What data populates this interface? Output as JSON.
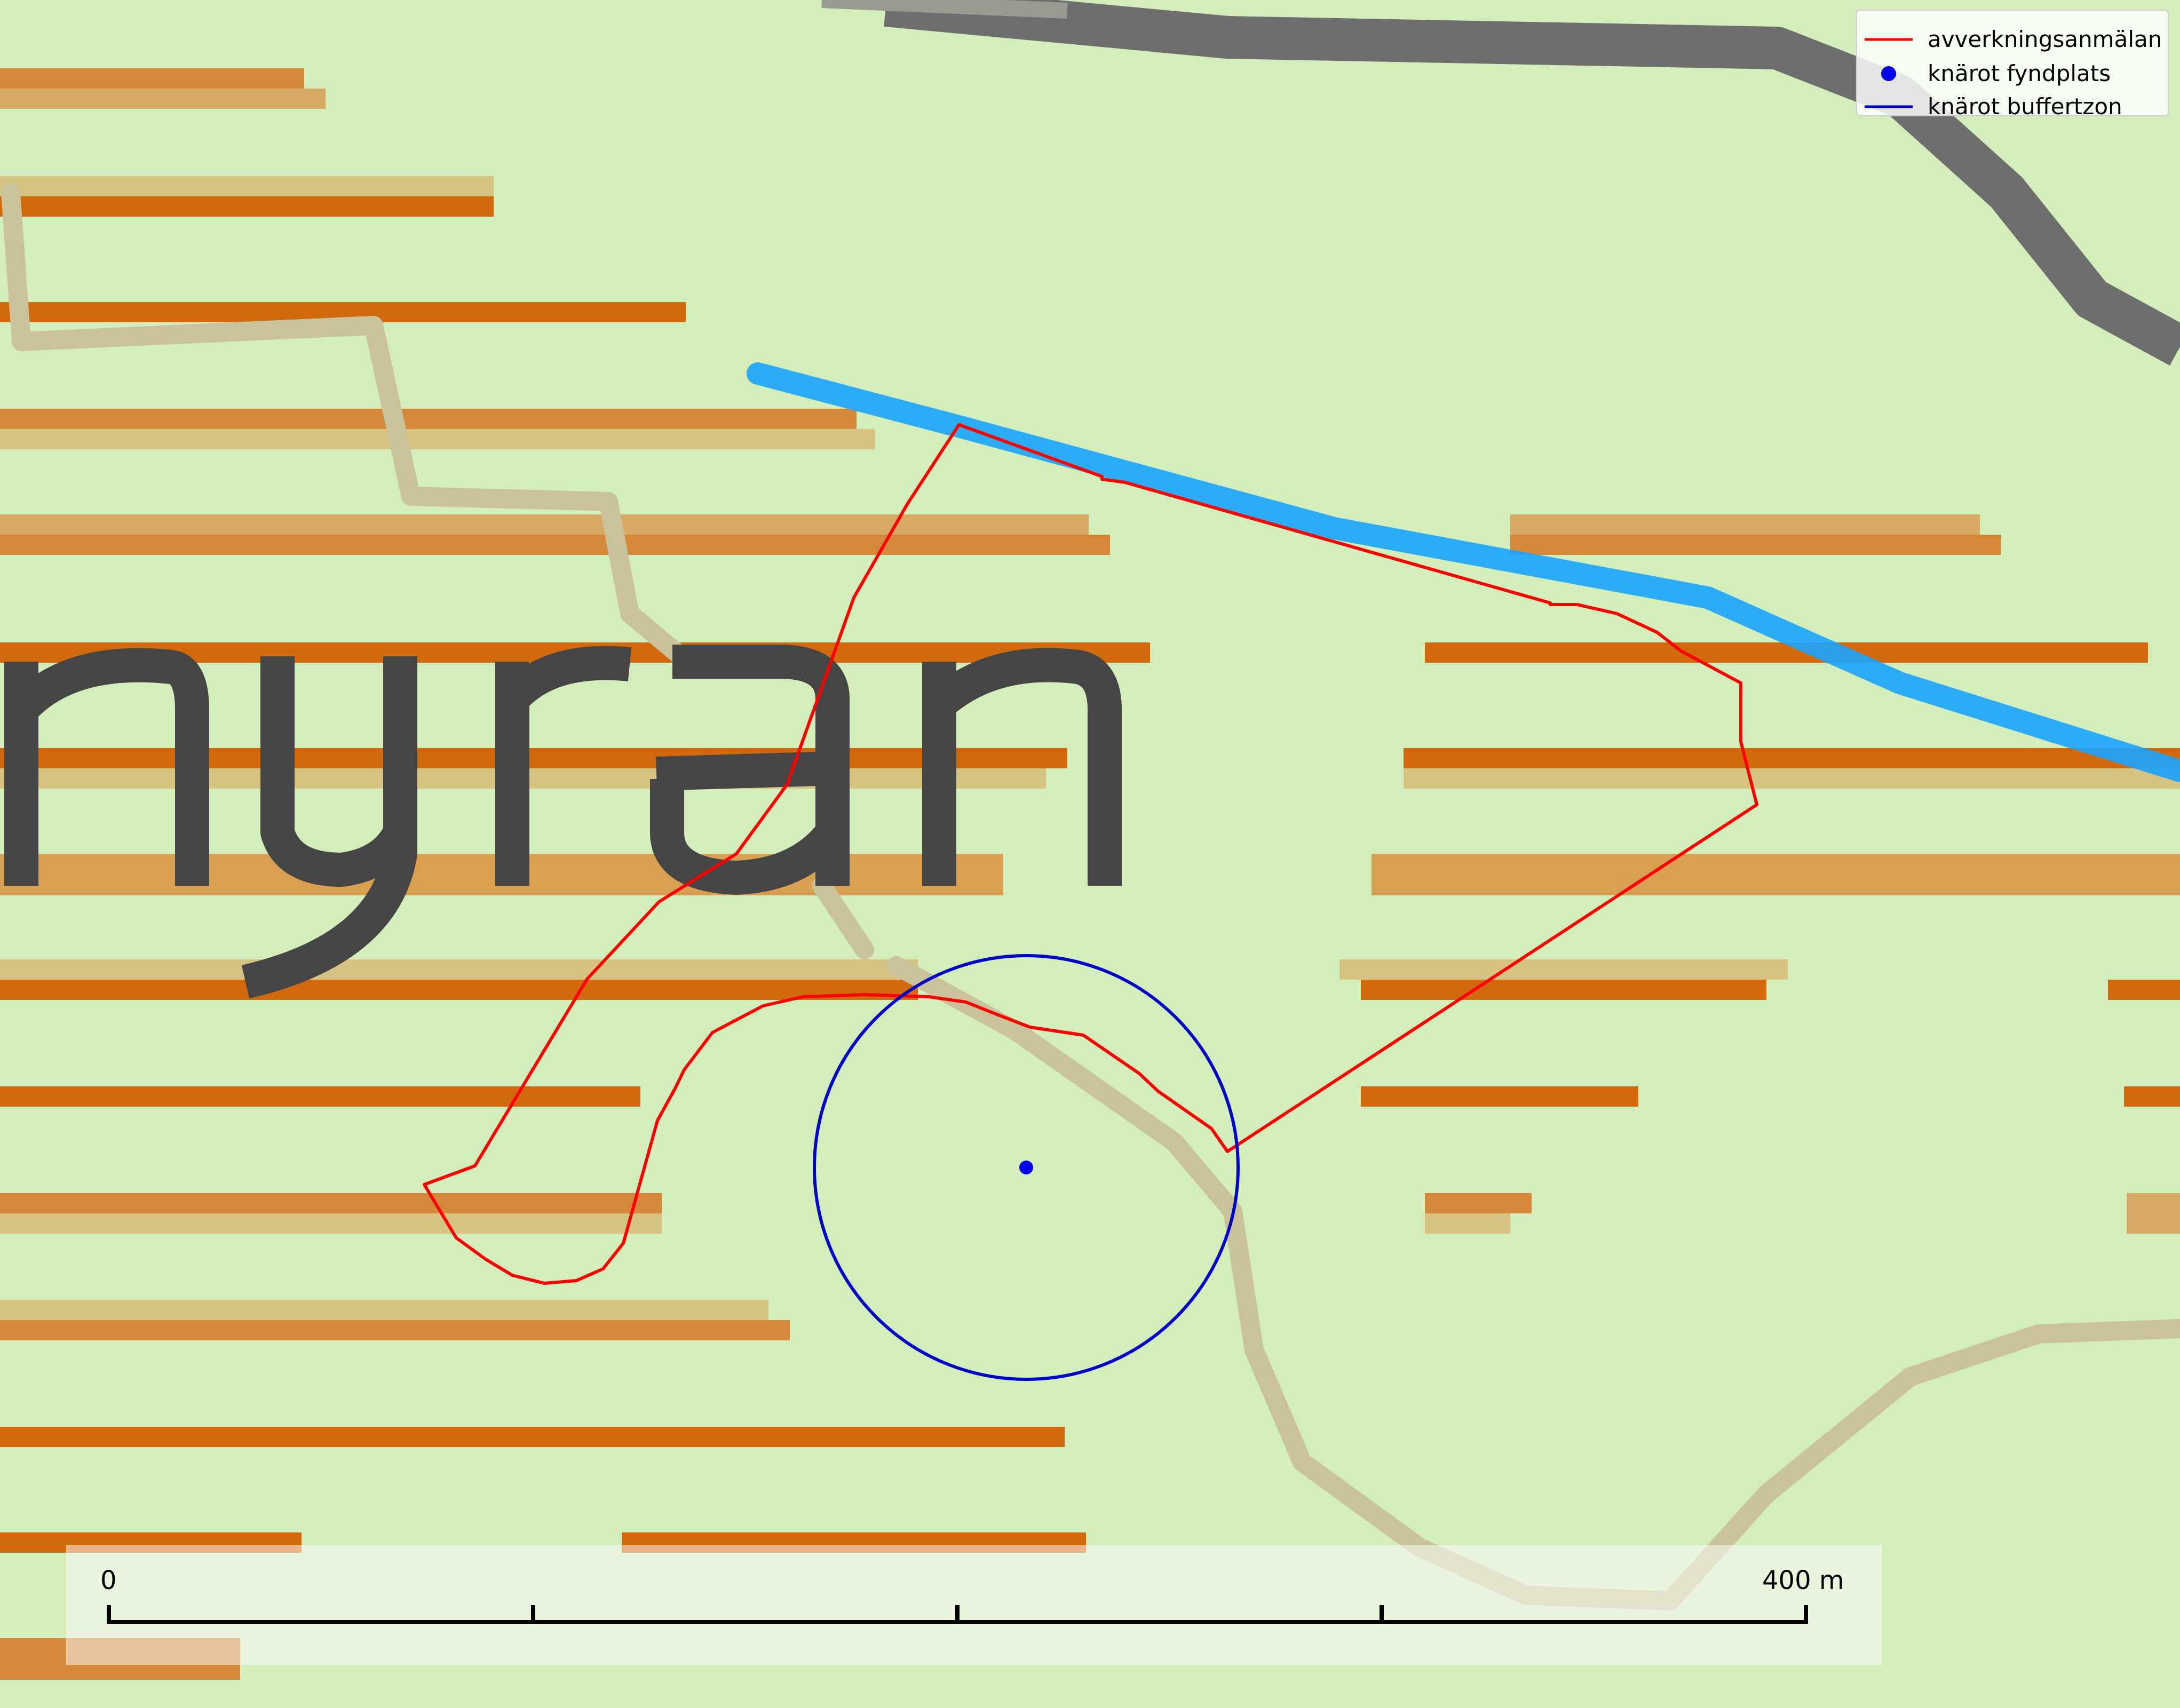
{
  "map": {
    "background_color": "#d3edbb",
    "place_name": "myran",
    "layers": {
      "terrain_bands_color": "#d4893a",
      "terrain_bands_dark_color": "#d2690c",
      "road_color": "#6e6e6e",
      "stream_color": "#1aa3ff",
      "path_color": "#c9c29a",
      "label_color": "#454545"
    },
    "overlays": {
      "notification_polygon": {
        "name": "avverkningsanmälan",
        "color": "#ff0000"
      },
      "find_point": {
        "name": "knärot fyndplats",
        "color": "#0000ee"
      },
      "buffer_zone": {
        "name": "knärot buffertzon",
        "color": "#0000cc"
      }
    }
  },
  "legend": {
    "items": [
      {
        "label": "avverkningsanmälan",
        "symbol": "line",
        "color": "#ff0000"
      },
      {
        "label": "knärot fyndplats",
        "symbol": "dot",
        "color": "#0000ee"
      },
      {
        "label": "knärot buffertzon",
        "symbol": "line",
        "color": "#0000cc"
      }
    ]
  },
  "scalebar": {
    "start_label": "0",
    "end_label": "400 m",
    "length_m": 400,
    "tick_count": 5
  }
}
